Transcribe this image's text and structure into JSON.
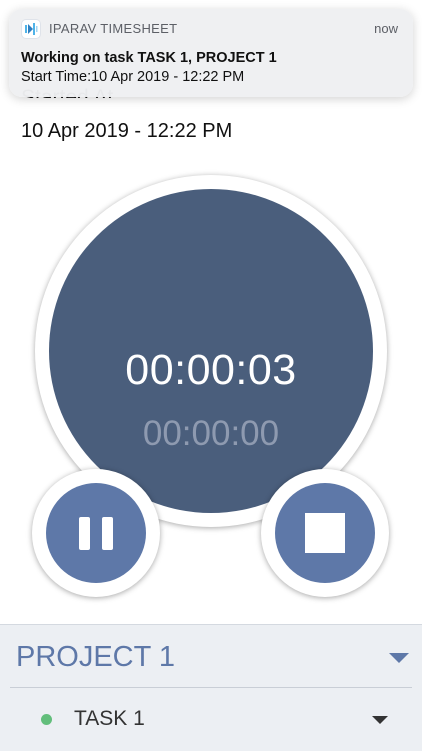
{
  "timer": {
    "started_heading": "Started At",
    "start_value": "10 Apr 2019 - 12:22 PM",
    "elapsed": "00:00:03",
    "secondary": "00:00:00"
  },
  "notification": {
    "app_name": "IPARAV TIMESHEET",
    "time": "now",
    "title": "Working on task TASK 1, PROJECT 1",
    "body": "Start Time:10 Apr 2019 - 12:22 PM",
    "icon": "iparav-app-icon"
  },
  "controls": {
    "pause_icon": "pause-icon",
    "stop_icon": "stop-icon"
  },
  "project": {
    "name": "PROJECT 1",
    "task": "TASK 1",
    "task_status_color": "#62be7b"
  },
  "colors": {
    "accent": "#5e78a8",
    "dial": "#4a5e7c",
    "panel": "#eceff3"
  }
}
